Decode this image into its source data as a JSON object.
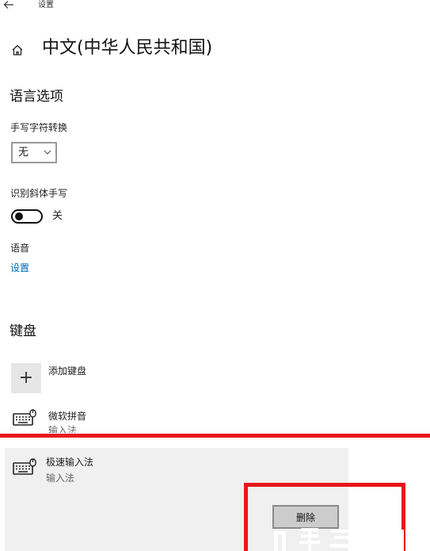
{
  "window": {
    "title": "设置",
    "back_icon": "back-arrow-icon"
  },
  "header": {
    "home_icon": "home-icon",
    "title": "中文(中华人民共和国)"
  },
  "language_options": {
    "heading": "语言选项",
    "handwriting_conversion": {
      "label": "手写字符转换",
      "value": "无"
    },
    "italic_handwriting": {
      "label": "识别斜体手写",
      "state": "关",
      "on": false
    },
    "speech": {
      "label": "语音",
      "link": "设置"
    }
  },
  "keyboards": {
    "heading": "键盘",
    "add_label": "添加键盘",
    "items": [
      {
        "name": "微软拼音",
        "type": "输入法",
        "icon": "keyboard-icon"
      },
      {
        "name": "极速输入法",
        "type": "输入法",
        "icon": "keyboard-icon",
        "selected": true
      }
    ],
    "remove_button": "删除"
  },
  "colors": {
    "accent_link": "#0067b8",
    "annotation_red": "#e8161b",
    "selected_bg": "#f0f0f0",
    "button_bg": "#cccccc"
  }
}
